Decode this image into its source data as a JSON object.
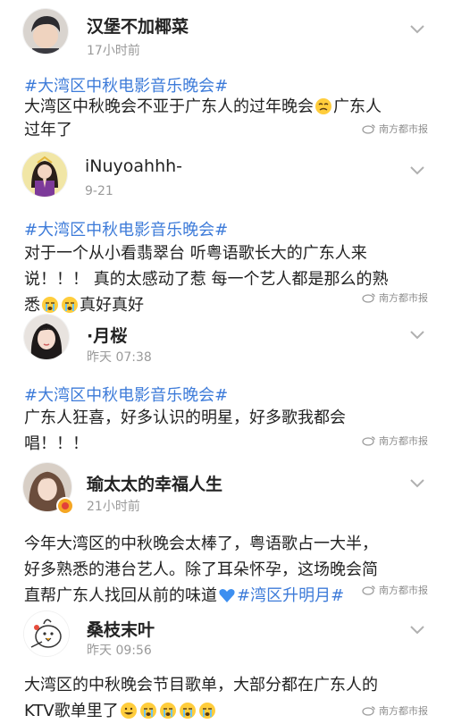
{
  "watermark": "南方都市报",
  "posts": [
    {
      "user": "汉堡不加椰菜",
      "time": "17小时前",
      "hashtag": "#大湾区中秋电影音乐晚会#",
      "text_a": "大湾区中秋晚会不亚于广东人的过年晚会",
      "text_b": "广东人",
      "text_c": "过年了",
      "avatar": "boy-with-short-hair-avatar"
    },
    {
      "user": "iNuyoahhh-",
      "time": "9-21",
      "hashtag": "#大湾区中秋电影音乐晚会#",
      "line1": "对于一个从小看翡翠台 听粤语歌长大的广东人来",
      "line2": "说！！！ 真的太感动了惹 每一个艺人都是那么的熟",
      "line3_a": "悉",
      "line3_b": "真好真好",
      "avatar": "girl-praying-avatar"
    },
    {
      "user": "·月桜",
      "time": "昨天 07:38",
      "hashtag": "#大湾区中秋电影音乐晚会#",
      "line1": "广东人狂喜，好多认识的明星，好多歌我都会",
      "line2": "唱！！！",
      "avatar": "girl-portrait-avatar"
    },
    {
      "user": "瑜太太的幸福人生",
      "time": "21小时前",
      "line1": "今年大湾区的中秋晚会太棒了，粤语歌占一大半，",
      "line2": "好多熟悉的港台艺人。除了耳朵怀孕，这场晚会简",
      "line3_a": "直帮广东人找回从前的味道",
      "line3_link": "#湾区升明月#",
      "avatar": "woman-portrait-avatar"
    },
    {
      "user": "桑枝末叶",
      "time": "昨天 09:56",
      "line1": "大湾区的中秋晚会节目歌单，大部分都在广东人的",
      "line2": "KTV歌单里了",
      "avatar": "cartoon-bird-avatar"
    }
  ]
}
